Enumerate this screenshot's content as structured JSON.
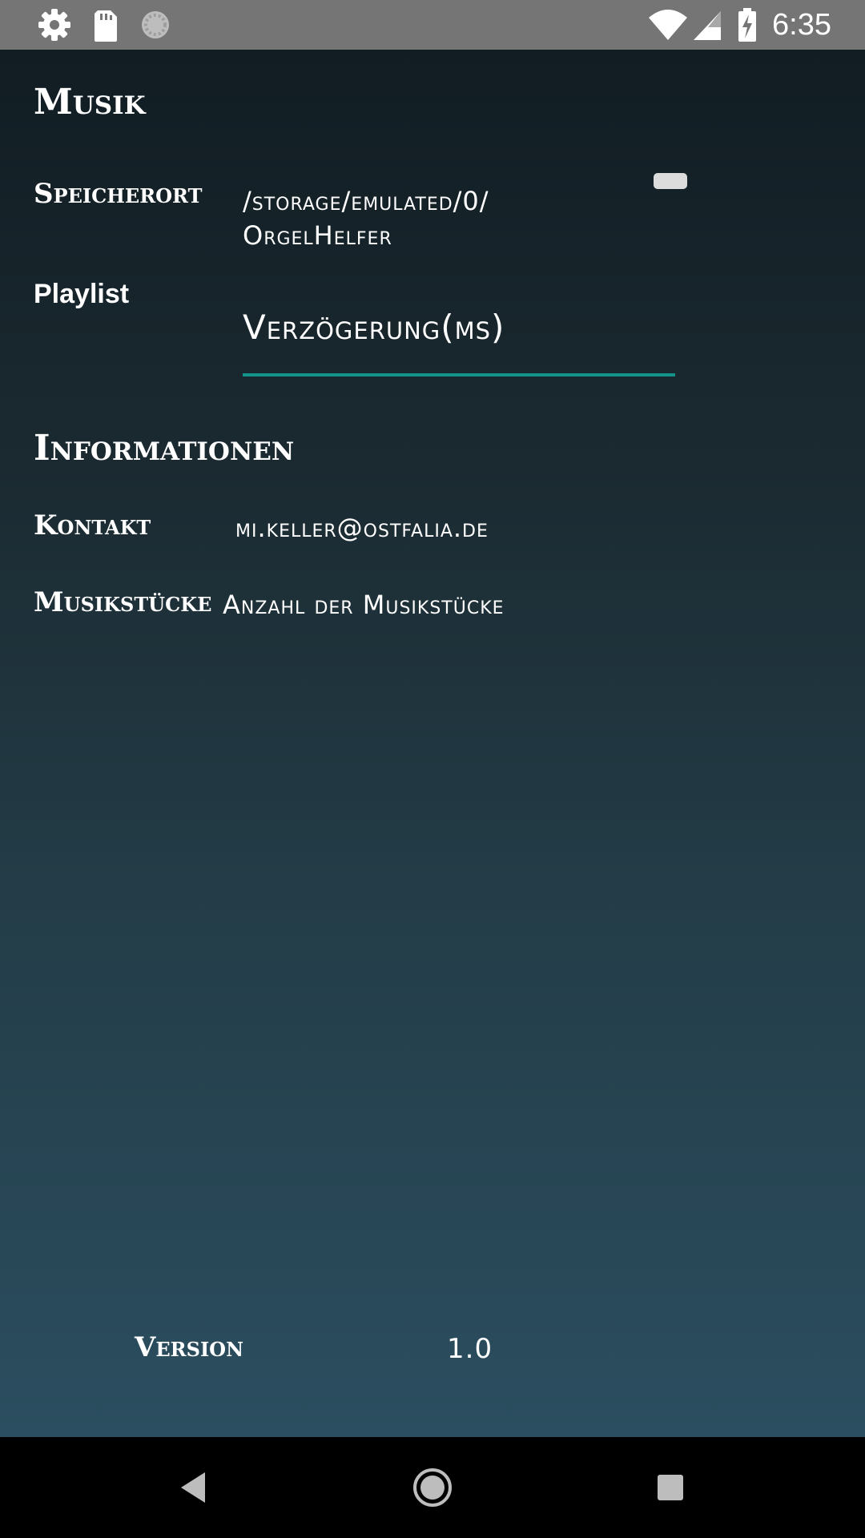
{
  "status_bar": {
    "time": "6:35",
    "left_icons": [
      "gear-icon",
      "sd-card-icon",
      "sync-icon"
    ],
    "right_icons": [
      "wifi-icon",
      "cell-signal-icon",
      "battery-charging-icon"
    ]
  },
  "sections": {
    "musik": {
      "title": "Musik",
      "speicherort_label": "Speicherort",
      "speicherort_value_line1": "/storage/emulated/0/",
      "speicherort_value_line2": "OrgelHelfer",
      "playlist_label": "Playlist",
      "delay_field_text": "Verzögerung(ms)"
    },
    "informationen": {
      "title": "Informationen",
      "kontakt_label": "Kontakt",
      "kontakt_value": "mi.keller@ostfalia.de",
      "musikstuecke_label": "Musikstücke",
      "musikstuecke_value": "Anzahl der Musikstücke"
    }
  },
  "footer": {
    "version_label": "Version",
    "version_value": "1.0"
  },
  "colors": {
    "status_bar": "#757575",
    "accent_underline": "#14938a",
    "background_top": "#111d23",
    "background_bottom": "#2b4e60",
    "nav_bar": "#000000"
  }
}
